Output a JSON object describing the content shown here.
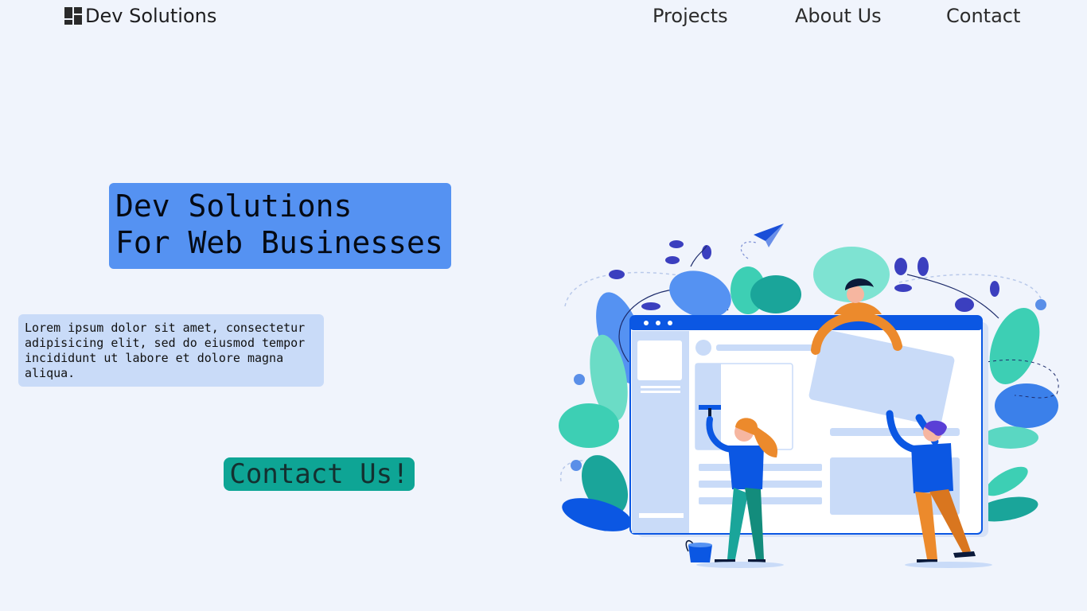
{
  "header": {
    "brand": "Dev Solutions",
    "logo_icon": "grid-logo-icon",
    "nav": [
      {
        "label": "Projects"
      },
      {
        "label": "About Us"
      },
      {
        "label": "Contact"
      }
    ]
  },
  "hero": {
    "title_line1": "Dev Solutions",
    "title_line2": "For Web Businesses",
    "description": "Lorem ipsum dolor sit amet, consectetur adipisicing elit, sed do eiusmod tempor incididunt ut labore et dolore magna aliqua.",
    "cta_label": "Contact Us!"
  },
  "colors": {
    "background": "#f0f4fc",
    "title_box": "#5592f2",
    "description_box": "#c9dbf8",
    "cta": "#0ea595",
    "illustration_blue": "#0b57e3",
    "illustration_teal": "#3dcfb4",
    "illustration_orange": "#ec8a2c"
  }
}
